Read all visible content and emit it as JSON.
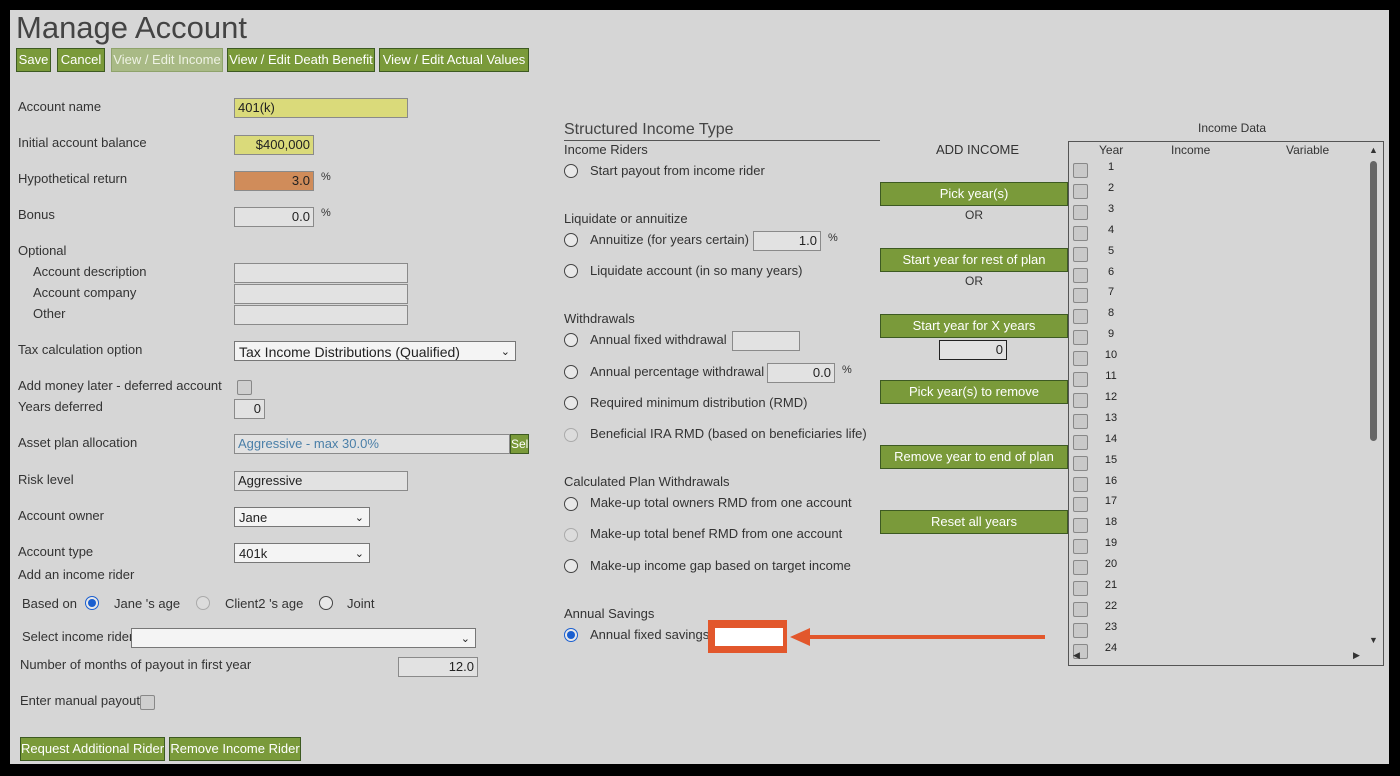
{
  "page_title": "Manage Account",
  "toolbar": {
    "save": "Save",
    "cancel": "Cancel",
    "view_edit_income": "View / Edit Income",
    "view_edit_death_benefit": "View / Edit Death Benefit",
    "view_edit_actual_values": "View / Edit Actual Values"
  },
  "form": {
    "account_name_label": "Account name",
    "account_name_value": "401(k)",
    "initial_balance_label": "Initial account balance",
    "initial_balance_value": "$400,000",
    "hyp_return_label": "Hypothetical return",
    "hyp_return_value": "3.0",
    "bonus_label": "Bonus",
    "bonus_value": "0.0",
    "percent": "%",
    "optional_label": "Optional",
    "account_description_label": "Account description",
    "account_company_label": "Account company",
    "other_label": "Other",
    "tax_calc_label": "Tax calculation option",
    "tax_calc_value": "Tax Income Distributions (Qualified)",
    "add_money_label": "Add money later - deferred account",
    "years_deferred_label": "Years deferred",
    "years_deferred_value": "0",
    "asset_plan_label": "Asset plan allocation",
    "asset_plan_value": "Aggressive - max 30.0%",
    "asset_plan_select": "Sel",
    "risk_level_label": "Risk level",
    "risk_level_value": "Aggressive",
    "account_owner_label": "Account owner",
    "account_owner_value": "Jane",
    "account_type_label": "Account type",
    "account_type_value": "401k",
    "add_income_rider_label": "Add an income rider",
    "based_on_label": "Based on",
    "based_on_options": [
      "Jane 's age",
      "Client2 's age",
      "Joint"
    ],
    "select_income_rider_label": "Select income rider",
    "select_income_rider_value": "",
    "months_payout_label": "Number of months of payout in first year",
    "months_payout_value": "12.0",
    "manual_payout_label": "Enter manual payout",
    "request_rider_button": "Request Additional Rider",
    "remove_rider_button": "Remove Income Rider"
  },
  "structured": {
    "heading": "Structured Income Type",
    "income_riders_label": "Income Riders",
    "start_payout": "Start payout from income rider",
    "liquidate_label": "Liquidate or annuitize",
    "annuitize": "Annuitize (for years certain)",
    "annuitize_value": "1.0",
    "liquidate": "Liquidate account (in so many years)",
    "withdrawals_label": "Withdrawals",
    "annual_fixed_withdrawal": "Annual fixed withdrawal",
    "annual_pct_withdrawal": "Annual percentage withdrawal",
    "annual_pct_value": "0.0",
    "rmd": "Required minimum distribution (RMD)",
    "beneficial_rmd": "Beneficial IRA RMD (based on beneficiaries life)",
    "calc_plan_label": "Calculated Plan Withdrawals",
    "makeup_owners": "Make-up total owners RMD from one account",
    "makeup_benef": "Make-up total benef RMD from one account",
    "makeup_gap": "Make-up income gap based on target income",
    "annual_savings_label": "Annual Savings",
    "annual_fixed_savings": "Annual fixed savings",
    "annual_fixed_savings_value": ""
  },
  "add_income": {
    "heading": "ADD INCOME",
    "pick_years": "Pick year(s)",
    "or": "OR",
    "start_rest": "Start year for rest of plan",
    "start_x": "Start year for X years",
    "x_years_value": "0",
    "pick_remove": "Pick year(s) to remove",
    "remove_end": "Remove year to end of plan",
    "reset_all": "Reset all years"
  },
  "income_data": {
    "title": "Income Data",
    "columns": [
      "Year",
      "Income",
      "Variable"
    ],
    "rows": [
      "1",
      "2",
      "3",
      "4",
      "5",
      "6",
      "7",
      "8",
      "9",
      "10",
      "11",
      "12",
      "13",
      "14",
      "15",
      "16",
      "17",
      "18",
      "19",
      "20",
      "21",
      "22",
      "23",
      "24"
    ]
  },
  "colors": {
    "button_green": "#7a9a3a",
    "yellow_field": "#dada7a",
    "orange_field": "#d08c5a",
    "annotation": "#e2572c",
    "radio_blue": "#1a5fd0"
  }
}
